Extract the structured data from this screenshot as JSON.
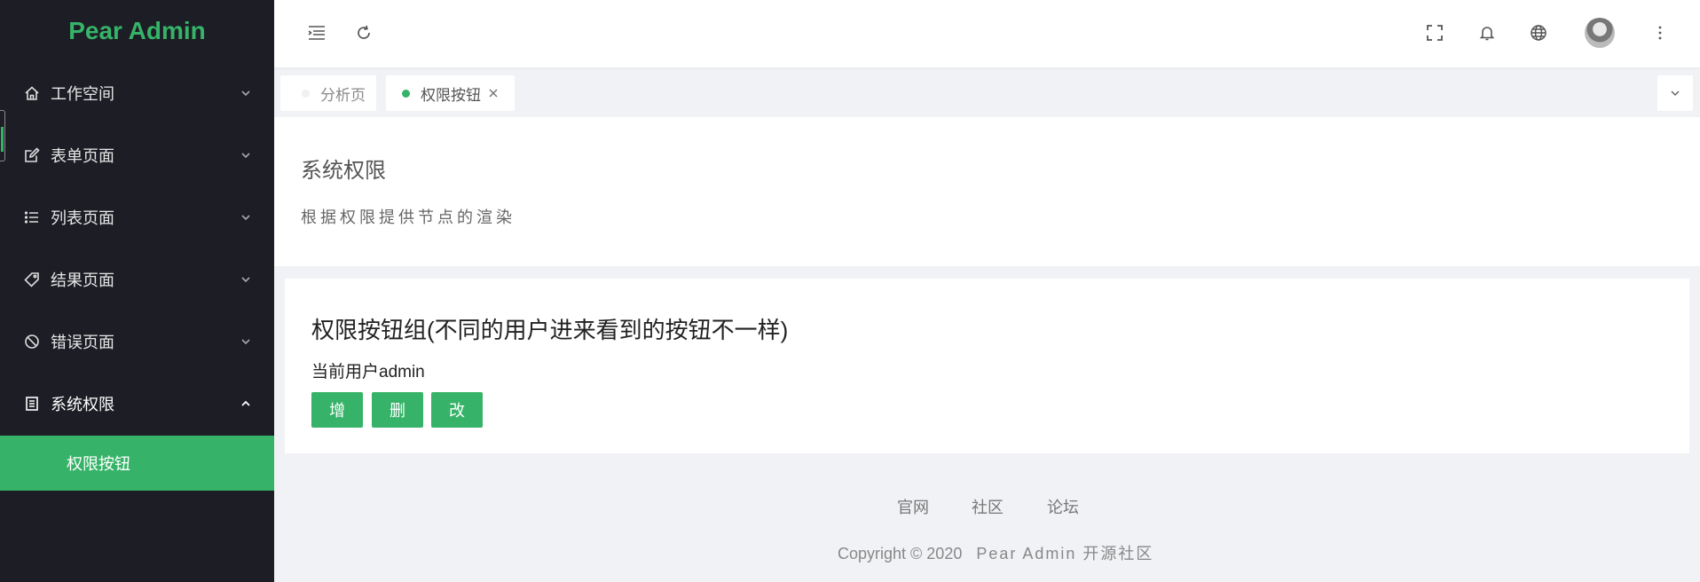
{
  "app": {
    "logo": "Pear Admin"
  },
  "sidebar": {
    "items": [
      {
        "label": "工作空间",
        "icon": "home-icon"
      },
      {
        "label": "表单页面",
        "icon": "edit-icon"
      },
      {
        "label": "列表页面",
        "icon": "list-icon"
      },
      {
        "label": "结果页面",
        "icon": "tag-icon"
      },
      {
        "label": "错误页面",
        "icon": "forbidden-icon"
      },
      {
        "label": "系统权限",
        "icon": "document-icon",
        "expanded": true
      }
    ],
    "active_sub": {
      "label": "权限按钮"
    },
    "accent": "#36b368",
    "background": "#1c1d25"
  },
  "header": {
    "icons": [
      "menu-fold-icon",
      "refresh-icon",
      "fullscreen-icon",
      "bell-icon",
      "globe-icon",
      "avatar",
      "more-vertical-icon"
    ]
  },
  "tabs": [
    {
      "label": "分析页",
      "active": false
    },
    {
      "label": "权限按钮",
      "active": true,
      "closable": true
    }
  ],
  "panel1": {
    "title": "系统权限",
    "description": "根据权限提供节点的渲染"
  },
  "panel2": {
    "title": "权限按钮组(不同的用户进来看到的按钮不一样)",
    "current_user": "当前用户admin",
    "buttons": [
      "增",
      "删",
      "改"
    ]
  },
  "footer": {
    "links": [
      "官网",
      "社区",
      "论坛"
    ],
    "copyright": "Copyright © 2020",
    "org": "Pear Admin 开源社区"
  }
}
